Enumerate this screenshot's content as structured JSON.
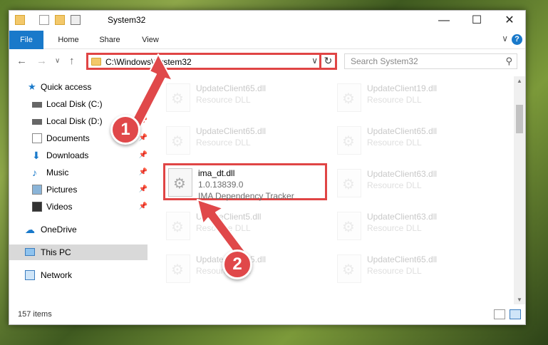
{
  "titlebar": {
    "title": "System32",
    "minimize": "—",
    "maximize": "☐",
    "close": "✕"
  },
  "ribbon": {
    "tabs": [
      {
        "label": "File"
      },
      {
        "label": "Home"
      },
      {
        "label": "Share"
      },
      {
        "label": "View"
      }
    ],
    "help": "?",
    "expand": "∨"
  },
  "navbar": {
    "back": "←",
    "forward": "→",
    "recent": "∨",
    "up": "↑",
    "address": "C:\\Windows\\System32",
    "dropdown": "∨",
    "refresh": "↻",
    "search_placeholder": "Search System32",
    "search_icon": "⚲"
  },
  "sidebar": {
    "items": [
      {
        "label": "Quick access",
        "icon": "star-icon",
        "color": "#1979ca"
      },
      {
        "label": "Local Disk (C:)",
        "icon": "drive-icon",
        "pinned": true
      },
      {
        "label": "Local Disk (D:)",
        "icon": "drive-icon",
        "pinned": true
      },
      {
        "label": "Documents",
        "icon": "documents-icon",
        "pinned": true
      },
      {
        "label": "Downloads",
        "icon": "downloads-icon",
        "pinned": true
      },
      {
        "label": "Music",
        "icon": "music-icon",
        "pinned": true
      },
      {
        "label": "Pictures",
        "icon": "pictures-icon",
        "pinned": true
      },
      {
        "label": "Videos",
        "icon": "videos-icon",
        "pinned": true
      },
      {
        "label": "OneDrive",
        "icon": "cloud-icon"
      },
      {
        "label": "This PC",
        "icon": "computer-icon",
        "selected": true
      },
      {
        "label": "Network",
        "icon": "network-icon"
      }
    ],
    "pin_glyph": "📌"
  },
  "files": [
    {
      "name": "UpdateClient65.dll",
      "line1": "Resource DLL",
      "line2": ""
    },
    {
      "name": "UpdateClient19.dll",
      "line1": "Resource DLL",
      "line2": ""
    },
    {
      "name": "UpdateClient65.dll",
      "line1": "Resource DLL",
      "line2": ""
    },
    {
      "name": "UpdateClient65.dll",
      "line1": "Resource DLL",
      "line2": ""
    },
    {
      "name": "ima_dt.dll",
      "line1": "1.0.13839.0",
      "line2": "IMA Dependency Tracker"
    },
    {
      "name": "UpdateClient63.dll",
      "line1": "Resource DLL",
      "line2": ""
    },
    {
      "name": "UpdateClient5.dll",
      "line1": "Resource DLL",
      "line2": ""
    },
    {
      "name": "UpdateClient63.dll",
      "line1": "Resource DLL",
      "line2": ""
    },
    {
      "name": "UpdateClient65.dll",
      "line1": "Resource DLL",
      "line2": ""
    },
    {
      "name": "UpdateClient65.dll",
      "line1": "Resource DLL",
      "line2": ""
    }
  ],
  "status": {
    "count": "157 items"
  },
  "callouts": [
    {
      "label": "1"
    },
    {
      "label": "2"
    }
  ],
  "colors": {
    "accent": "#1979ca",
    "highlight": "#e04545"
  }
}
